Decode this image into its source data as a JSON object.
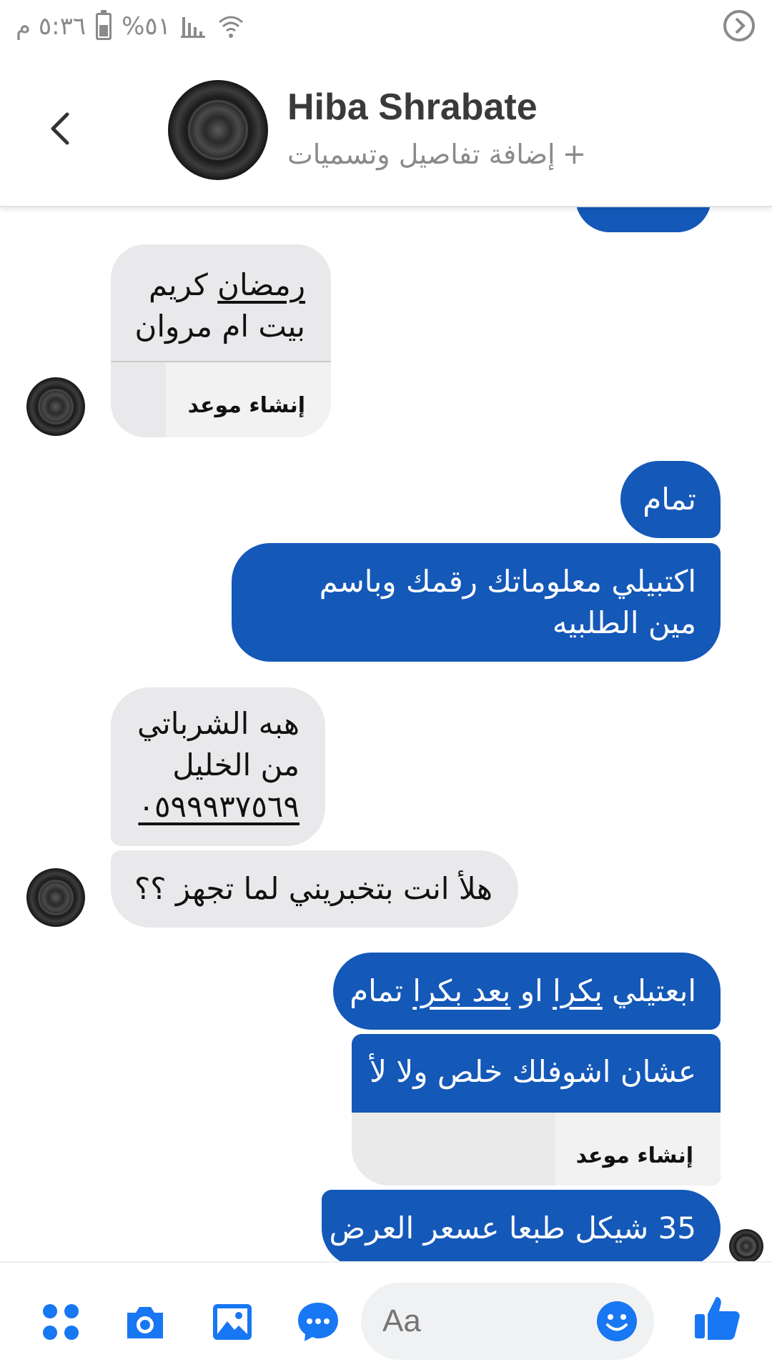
{
  "status_bar": {
    "time": "٥:٣٦ م",
    "battery": "%٥١",
    "battery_level": 0.51
  },
  "header": {
    "name": "Hiba Shrabate",
    "subtitle": "إضافة تفاصيل وتسميات",
    "subtitle_plus": "+"
  },
  "messages": [
    {
      "side": "in",
      "text_line1_underlined": "رمضان",
      "text_line1_rest": " كريم",
      "text_line2": "بيت ام مروان",
      "action": "إنشاء موعد"
    },
    {
      "side": "out",
      "text": "تمام"
    },
    {
      "side": "out",
      "text": "اكتبيلي معلوماتك رقمك وباسم مين الطلبيه"
    },
    {
      "side": "in",
      "line1": "هبه الشرباتي",
      "line2": "من الخليل",
      "phone": "٠٥٩٩٩٣٧٥٦٩"
    },
    {
      "side": "in",
      "text": "هلأ انت بتخبريني لما تجهز ؟؟"
    },
    {
      "side": "out",
      "part1": "ابعتيلي ",
      "part2_u": "بكرا",
      "part3": " او ",
      "part4_u": "بعد بكرا",
      "part5": " تمام"
    },
    {
      "side": "out",
      "text": "عشان اشوفلك خلص ولا لأ",
      "action": "إنشاء موعد"
    },
    {
      "side": "out",
      "text": "35 شيكل طبعا عسعر العرض"
    }
  ],
  "composer": {
    "placeholder": "Aa"
  },
  "colors": {
    "outgoing_bubble": "#1458b8",
    "incoming_bubble": "#e9e9eb",
    "accent": "#1877f2"
  }
}
